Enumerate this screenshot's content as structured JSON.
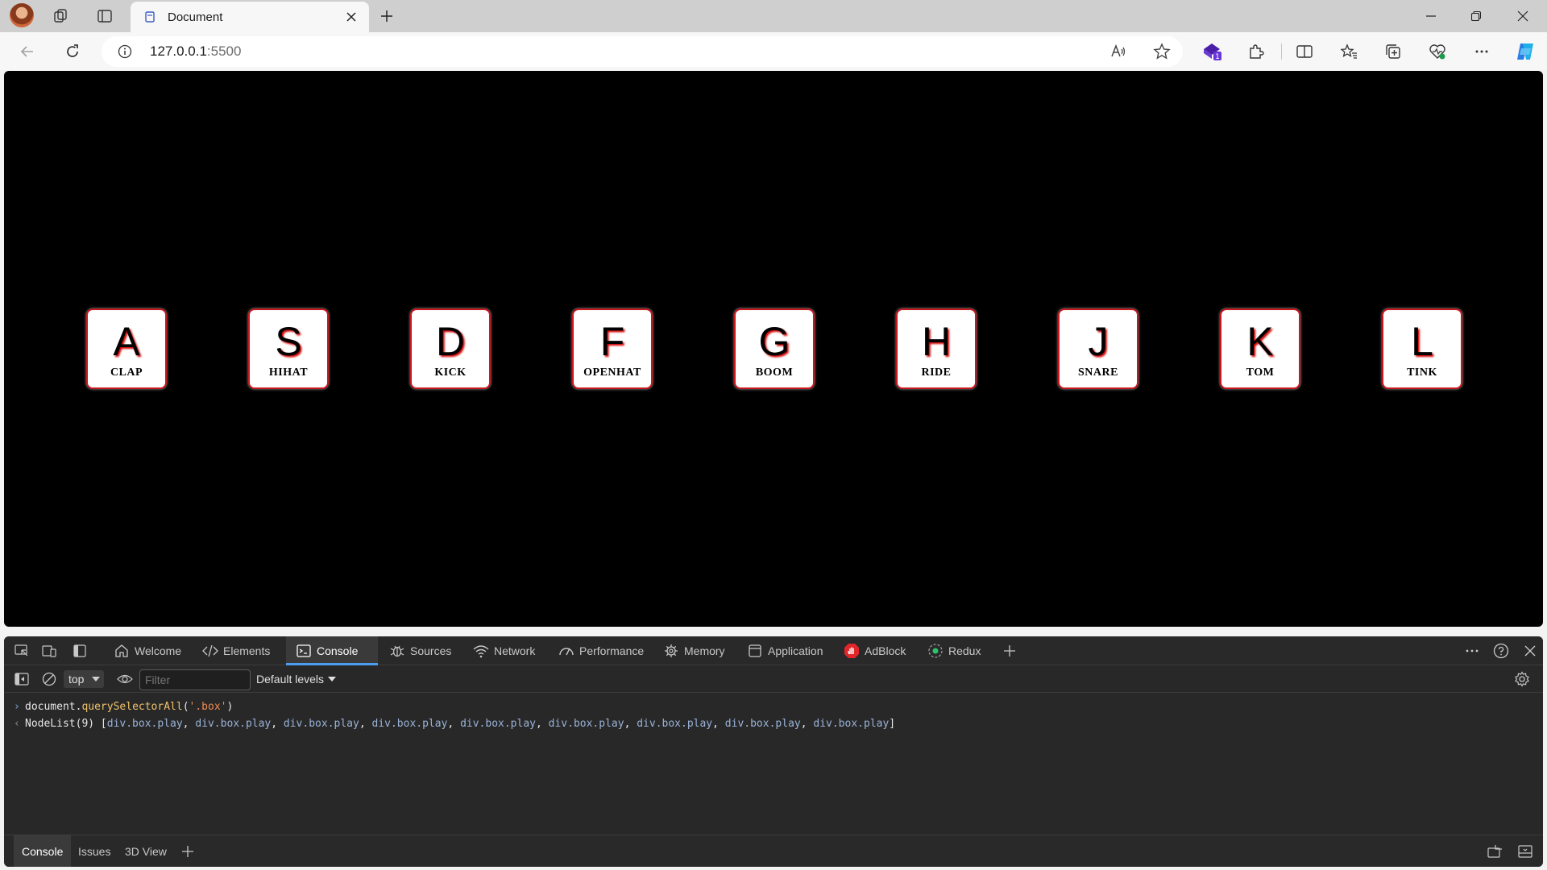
{
  "browser": {
    "tab_title": "Document",
    "url_host": "127.0.0.1",
    "url_port": ":5500"
  },
  "page": {
    "keys": [
      {
        "key": "A",
        "sound": "CLAP"
      },
      {
        "key": "S",
        "sound": "HIHAT"
      },
      {
        "key": "D",
        "sound": "KICK"
      },
      {
        "key": "F",
        "sound": "OPENHAT"
      },
      {
        "key": "G",
        "sound": "BOOM"
      },
      {
        "key": "H",
        "sound": "RIDE"
      },
      {
        "key": "J",
        "sound": "SNARE"
      },
      {
        "key": "K",
        "sound": "TOM"
      },
      {
        "key": "L",
        "sound": "TINK"
      }
    ]
  },
  "devtools": {
    "tabs": [
      "Welcome",
      "Elements",
      "Console",
      "Sources",
      "Network",
      "Performance",
      "Memory",
      "Application",
      "AdBlock",
      "Redux"
    ],
    "active_tab": "Console",
    "context": "top",
    "filter_placeholder": "Filter",
    "levels": "Default levels",
    "console": {
      "input": {
        "obj": "document.",
        "method": "querySelectorAll",
        "open": "(",
        "arg": "'.box'",
        "close": ")"
      },
      "output_prefix": "NodeList(9) [",
      "output_items": [
        "div.box.play",
        "div.box.play",
        "div.box.play",
        "div.box.play",
        "div.box.play",
        "div.box.play",
        "div.box.play",
        "div.box.play",
        "div.box.play"
      ],
      "output_suffix": "]"
    },
    "drawer_tabs": [
      "Console",
      "Issues",
      "3D View"
    ]
  },
  "colors": {
    "key_border": "#c8171d",
    "active_tab_underline": "#4c9ff0"
  }
}
